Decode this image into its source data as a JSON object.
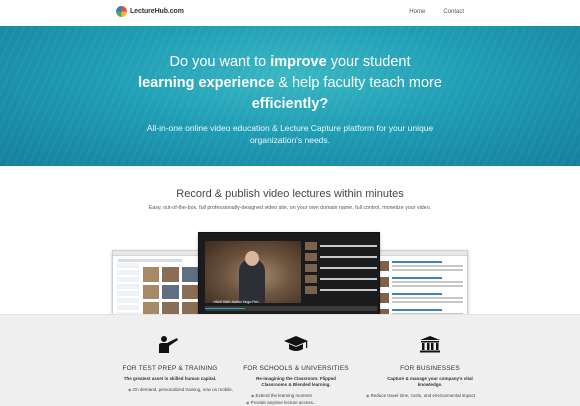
{
  "nav": {
    "brand": "LectureHub.com",
    "links": [
      "Home",
      "Contact"
    ]
  },
  "hero": {
    "title_pre": "Do you want to ",
    "title_strong_1": "improve",
    "title_mid_1": " your student",
    "title_strong_2": "learning experience",
    "title_mid_2": " & help faculty teach more",
    "title_strong_3": "efficiently?",
    "subtitle": "All-in-one online video education & Lecture Capture platform for your unique organization's needs."
  },
  "section": {
    "title": "Record & publish video lectures within minutes",
    "subtitle": "Easy, out-of-the-box, full professionally-designed video site, on your own domain name, full control, monetize your video."
  },
  "mock": {
    "video_caption": "«Wolf Hall» Author Hugo Feri..."
  },
  "features": [
    {
      "icon": "presenter-icon",
      "title": "FOR TEST PREP & TRAINING",
      "desc": "The greatest asset is skilled human capital.",
      "items": [
        "On demand, personalized training, now on mobile,"
      ]
    },
    {
      "icon": "graduation-cap-icon",
      "title": "FOR SCHOOLS & UNIVERSITIES",
      "desc": "Re-imagining the Classroom: Flipped Classrooms & Blended learning.",
      "items": [
        "Extend the learning moment",
        "Provide anytime lecture access..."
      ]
    },
    {
      "icon": "institution-icon",
      "title": "FOR BUSINESSES",
      "desc": "Capture & manage your company's vital knowledge.",
      "items": [
        "Reduce travel time, costs, and environmental impact"
      ]
    }
  ],
  "colors": {
    "hero_accent": "#1f9db4",
    "features_bg": "#efefef"
  }
}
